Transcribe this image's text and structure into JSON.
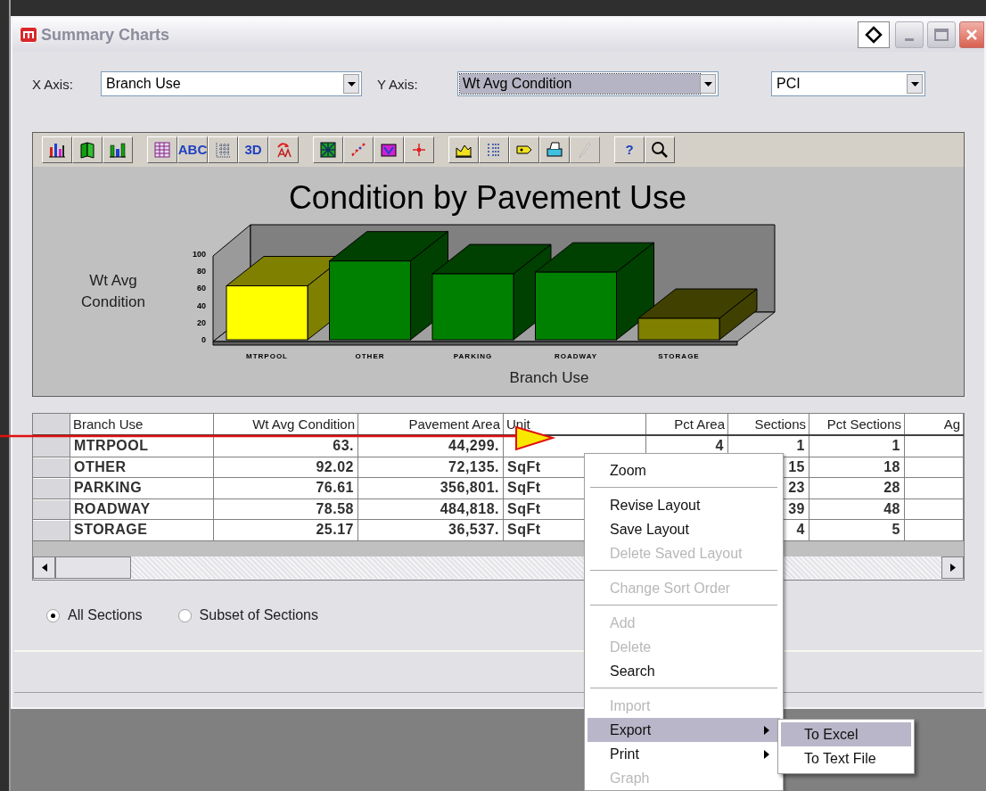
{
  "window": {
    "title": "Summary Charts"
  },
  "selectors": [
    {
      "label": "X Axis:",
      "value": "Branch Use",
      "highlighted": false
    },
    {
      "label": "Y Axis:",
      "value": "Wt Avg Condition",
      "highlighted": true
    },
    {
      "value": "PCI",
      "highlighted": false
    }
  ],
  "toolbar": [
    [
      {
        "kind": "bar-chart"
      },
      {
        "kind": "book"
      },
      {
        "kind": "bar-chart-2"
      }
    ],
    [
      {
        "kind": "table"
      },
      {
        "kind": "text",
        "label": "ABC"
      },
      {
        "kind": "grid-lines"
      },
      {
        "kind": "text",
        "label": "3D"
      },
      {
        "kind": "rotate"
      }
    ],
    [
      {
        "kind": "pattern"
      },
      {
        "kind": "scatter"
      },
      {
        "kind": "palette"
      },
      {
        "kind": "crosshair"
      }
    ],
    [
      {
        "kind": "area"
      },
      {
        "kind": "list"
      },
      {
        "kind": "tag"
      },
      {
        "kind": "printer"
      },
      {
        "kind": "pencil",
        "disabled": true
      }
    ],
    [
      {
        "kind": "text",
        "label": "?"
      },
      {
        "kind": "search"
      }
    ]
  ],
  "chart_data": {
    "type": "bar",
    "title": "Condition by Pavement Use",
    "xlabel": "Branch Use",
    "ylabel": "Wt Avg Condition",
    "categories": [
      "MTRPOOL",
      "OTHER",
      "PARKING",
      "ROADWAY",
      "STORAGE"
    ],
    "values": [
      63,
      92,
      77,
      79,
      25
    ],
    "ylim": [
      0,
      100
    ],
    "yticks": [
      0,
      20,
      40,
      60,
      80,
      100
    ]
  },
  "table": {
    "columns": [
      "Branch Use",
      "Wt Avg Condition",
      "Pavement Area",
      "Unit",
      "Pct Area",
      "Sections",
      "Pct Sections",
      "Ag"
    ],
    "rows": [
      [
        "MTRPOOL",
        "63.",
        "44,299.",
        null,
        "4",
        "1",
        "1"
      ],
      [
        "OTHER",
        "92.02",
        "72,135.",
        "SqFt",
        null,
        "15",
        "18"
      ],
      [
        "PARKING",
        "76.61",
        "356,801.",
        "SqFt",
        null,
        "23",
        "28"
      ],
      [
        "ROADWAY",
        "78.58",
        "484,818.",
        "SqFt",
        null,
        "39",
        "48"
      ],
      [
        "STORAGE",
        "25.17",
        "36,537.",
        "SqFt",
        null,
        "4",
        "5"
      ]
    ]
  },
  "scope": [
    {
      "label": "All Sections",
      "selected": true
    },
    {
      "label": "Subset of Sections",
      "selected": false
    }
  ],
  "context_menu": [
    {
      "kind": "item",
      "label": "Zoom",
      "disabled": false
    },
    {
      "kind": "separator"
    },
    {
      "kind": "item",
      "label": "Revise Layout",
      "disabled": false
    },
    {
      "kind": "item",
      "label": "Save Layout",
      "disabled": false
    },
    {
      "kind": "item",
      "label": "Delete Saved Layout",
      "disabled": true
    },
    {
      "kind": "separator"
    },
    {
      "kind": "item",
      "label": "Change Sort Order",
      "disabled": true
    },
    {
      "kind": "separator"
    },
    {
      "kind": "item",
      "label": "Add",
      "disabled": true
    },
    {
      "kind": "item",
      "label": "Delete",
      "disabled": true
    },
    {
      "kind": "item",
      "label": "Search",
      "disabled": false
    },
    {
      "kind": "separator"
    },
    {
      "kind": "item",
      "label": "Import",
      "disabled": true
    },
    {
      "kind": "item",
      "label": "Export",
      "disabled": false,
      "selected": true,
      "has_submenu": true,
      "submenu": [
        {
          "label": "To Excel",
          "selected": true
        },
        {
          "label": "To Text File",
          "selected": false
        }
      ]
    },
    {
      "kind": "item",
      "label": "Print",
      "disabled": false,
      "selected": false,
      "has_submenu": true
    },
    {
      "kind": "item",
      "label": "Graph",
      "disabled": true
    }
  ]
}
